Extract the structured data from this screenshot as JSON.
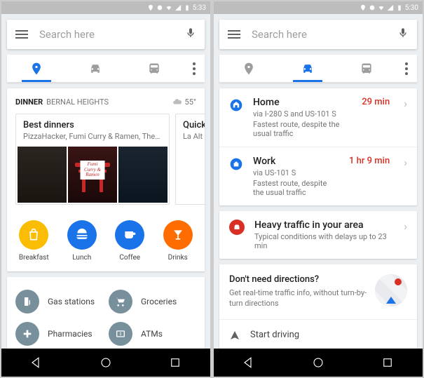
{
  "phones": [
    {
      "status_time": "5:33",
      "search_placeholder": "Search here",
      "active_tab": 0,
      "dinner": {
        "label": "DINNER",
        "location": "BERNAL HEIGHTS",
        "temp": "55°",
        "cards": [
          {
            "title": "Best dinners",
            "subtitle": "PizzaHacker, Fumi Curry & Ramen, The Front...",
            "sign": "Fumi Curry & Ramen"
          },
          {
            "title": "Quick",
            "subtitle": "La Alt"
          }
        ]
      },
      "categories": [
        {
          "name": "Breakfast",
          "color": "#fbbc04",
          "icon": "bag"
        },
        {
          "name": "Lunch",
          "color": "#1a73e8",
          "icon": "burger"
        },
        {
          "name": "Coffee",
          "color": "#1a73e8",
          "icon": "cup"
        },
        {
          "name": "Drinks",
          "color": "#ff6d00",
          "icon": "cocktail"
        }
      ],
      "services": [
        {
          "name": "Gas stations",
          "icon": "gas"
        },
        {
          "name": "Groceries",
          "icon": "cart"
        },
        {
          "name": "Pharmacies",
          "icon": "pharmacy"
        },
        {
          "name": "ATMs",
          "icon": "atm"
        }
      ]
    },
    {
      "status_time": "5:30",
      "search_placeholder": "Search here",
      "active_tab": 1,
      "destinations": [
        {
          "name": "Home",
          "via": "via I-280 S and US-101 S",
          "note": "Fastest route, despite the usual traffic",
          "time": "29 min",
          "icon": "home"
        },
        {
          "name": "Work",
          "via": "via US-101 S",
          "note": "Fastest route, despite the usual traffic",
          "time": "1 hr 9 min",
          "icon": "work"
        }
      ],
      "traffic": {
        "title": "Heavy traffic in your area",
        "subtitle": "Typical conditions with delays up to 23 min"
      },
      "nodir": {
        "title": "Don't need directions?",
        "subtitle": "Get real-time traffic info, without turn-by-turn directions"
      },
      "start_driving": "Start driving"
    }
  ]
}
